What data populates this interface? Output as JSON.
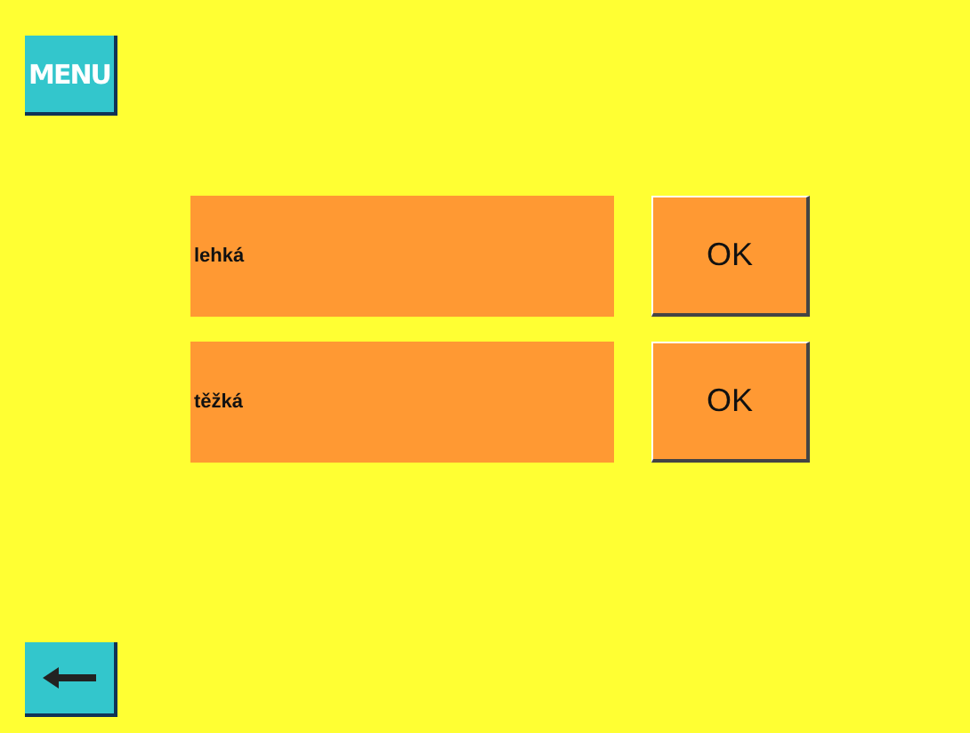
{
  "menu_button": {
    "label": "MENU"
  },
  "options": [
    {
      "label": "lehká",
      "button": "OK"
    },
    {
      "label": "těžká",
      "button": "OK"
    }
  ]
}
